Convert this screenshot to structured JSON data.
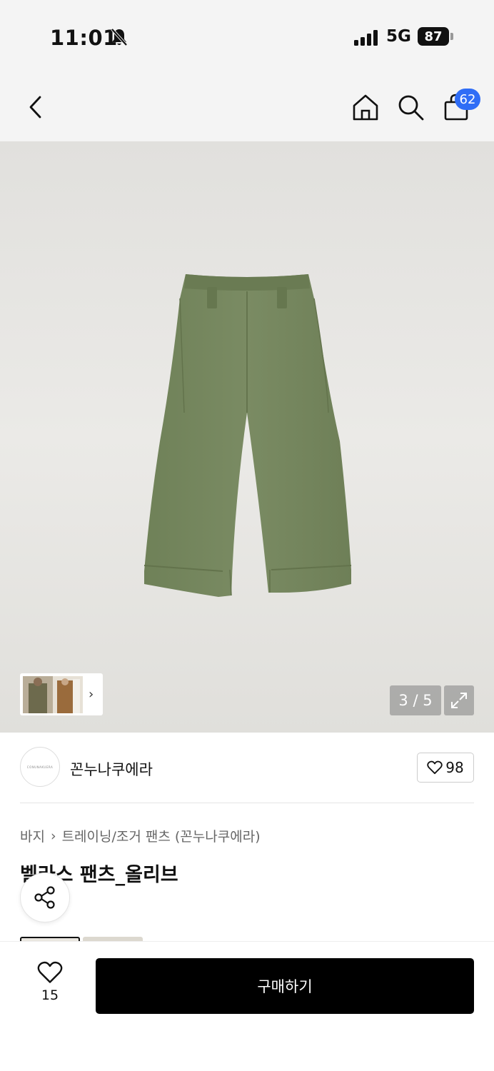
{
  "status_bar": {
    "time": "11:01",
    "network": "5G",
    "battery": "87"
  },
  "nav": {
    "cart_badge": "62"
  },
  "gallery": {
    "counter": "3 / 5",
    "thumb_chevron": "›"
  },
  "brand": {
    "name": "꼰누나쿠에라",
    "logo_text": "CONUNAKUERA",
    "likes": "98"
  },
  "breadcrumb": {
    "category": "바지",
    "separator": "›",
    "subcategory": "트레이닝/조거 팬츠 (꼰누나쿠에라)"
  },
  "product": {
    "title": "벨라스 팬츠_올리브"
  },
  "bottom": {
    "wish_count": "15",
    "buy_label": "구매하기"
  },
  "colors": {
    "accent_badge": "#2f6df6",
    "buy_button": "#000000",
    "pants": "#76875f"
  },
  "icons": [
    "back-icon",
    "home-icon",
    "search-icon",
    "bag-icon",
    "expand-icon",
    "heart-icon",
    "share-icon",
    "bell-off-icon",
    "signal-icon"
  ]
}
